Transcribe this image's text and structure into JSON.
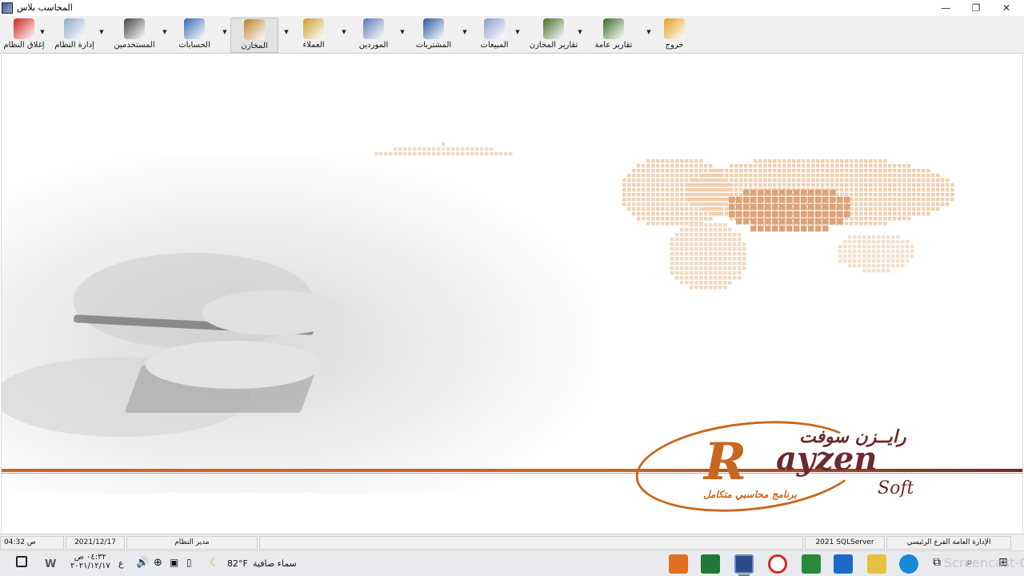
{
  "window": {
    "title": "المحاسب بلاس",
    "minimize": "—",
    "restore": "❐",
    "close": "✕"
  },
  "toolbar": {
    "items": [
      {
        "label": "خروج",
        "icon": "lock-icon",
        "color": "#e0a020"
      },
      {
        "label": "تقارير عامة",
        "icon": "report-chart-icon",
        "color": "#3d6b2a"
      },
      {
        "label": "تقارير المخازن",
        "icon": "warehouse-report-icon",
        "color": "#4a6b2a"
      },
      {
        "label": "المبيعات",
        "icon": "sales-icon",
        "color": "#8a9acd"
      },
      {
        "label": "المشتريات",
        "icon": "purchases-icon",
        "color": "#2a5aa0"
      },
      {
        "label": "الموردين",
        "icon": "suppliers-icon",
        "color": "#5a7ab0"
      },
      {
        "label": "العملاء",
        "icon": "customers-icon",
        "color": "#c9a030"
      },
      {
        "label": "المخازن",
        "icon": "warehouse-icon",
        "color": "#b8812a"
      },
      {
        "label": "الحسابات",
        "icon": "accounts-icon",
        "color": "#3a6ab0"
      },
      {
        "label": "المستخدمين",
        "icon": "users-icon",
        "color": "#444444"
      },
      {
        "label": "إدارة النظام",
        "icon": "gear-icon",
        "color": "#8aaacc"
      },
      {
        "label": "إغلاق النظام",
        "icon": "power-icon",
        "color": "#d02020"
      }
    ]
  },
  "branding": {
    "arabic_name": "رايــزن سوفت",
    "logo_r": "R",
    "logo_rest": "ayzen",
    "logo_soft": "Soft",
    "tagline": "برنامج محاسبي متكامل"
  },
  "statusbar": {
    "time": "04:32 ص",
    "date": "2021/12/17",
    "user": "مدير النظام",
    "server": "2021 SQLServer",
    "branch": "الإدارة العامة الفرع الرئيسي"
  },
  "taskbar": {
    "clock_time": "٠٤:٣٢ ص",
    "clock_date": "٢٠٢١/١٢/١٧",
    "lang": "ع",
    "weather_temp": "82°F",
    "weather_text": "سماء صافية",
    "watermark": "Screencast-O-Matic"
  },
  "colors": {
    "accent_orange": "#c8671f",
    "accent_maroon": "#6b2a2f",
    "toolbar_bg": "#f0f0f0"
  }
}
